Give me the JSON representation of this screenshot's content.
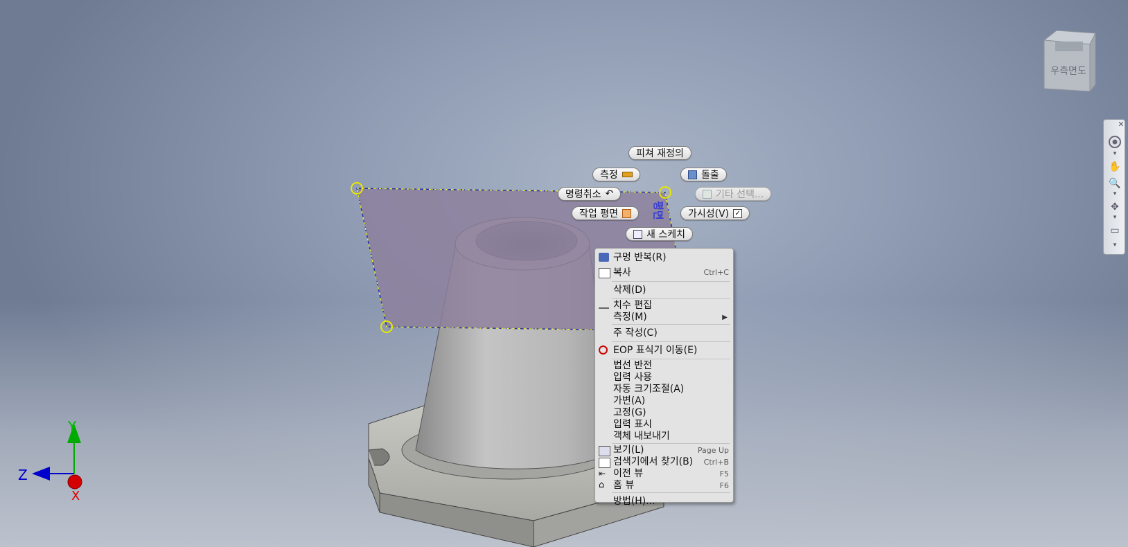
{
  "viewcube": {
    "face_label": "우측면도"
  },
  "axes": {
    "x_label": "X",
    "y_label": "Y",
    "z_label": "Z"
  },
  "plane_label": "평면",
  "marking_menu": {
    "redefine_feature": "피쳐 재정의",
    "measure": "측정",
    "extrude": "돌출",
    "undo": "명령취소",
    "select_other": "기타 선택...",
    "work_plane": "작업 평면",
    "visibility": "가시성(V)",
    "new_sketch": "새 스케치"
  },
  "context_menu": {
    "items": [
      {
        "label": "구멍 반복(R)",
        "icon": "hole-repeat-icon"
      },
      {
        "label": "복사",
        "shortcut": "Ctrl+C",
        "icon": "copy-icon"
      },
      {
        "label": "삭제(D)"
      },
      {
        "label": "치수 편집",
        "icon": "dimension-edit-icon"
      },
      {
        "label": "측정(M)",
        "submenu": true
      },
      {
        "label": "주 작성(C)"
      },
      {
        "label": "EOP 표식기 이동(E)",
        "icon": "eop-marker-icon"
      },
      {
        "label": "법선 반전"
      },
      {
        "label": "입력 사용"
      },
      {
        "label": "자동 크기조절(A)"
      },
      {
        "label": "가변(A)"
      },
      {
        "label": "고정(G)"
      },
      {
        "label": "입력 표시"
      },
      {
        "label": "객체 내보내기"
      },
      {
        "label": "보기(L)",
        "shortcut": "Page Up",
        "icon": "view-icon"
      },
      {
        "label": "검색기에서 찾기(B)",
        "shortcut": "Ctrl+B",
        "icon": "find-in-browser-icon"
      },
      {
        "label": "이전 뷰",
        "shortcut": "F5",
        "icon": "previous-view-icon"
      },
      {
        "label": "홈 뷰",
        "shortcut": "F6",
        "icon": "home-icon"
      },
      {
        "label": "방법(H)..."
      }
    ]
  },
  "colors": {
    "plane_fill": "#8c7f9c",
    "highlight_dash": "#ffff00",
    "axis_x": "#dd0000",
    "axis_y": "#00aa00",
    "axis_z": "#0000cc"
  }
}
